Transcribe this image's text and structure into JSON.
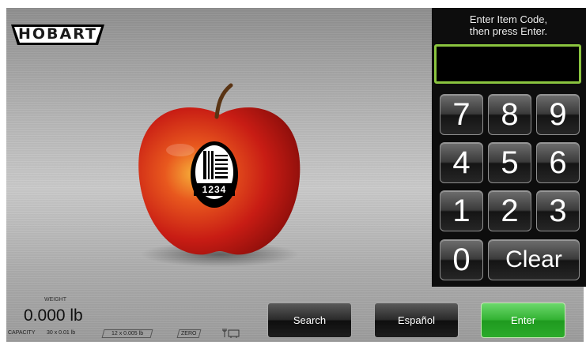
{
  "brand": {
    "logo_text": "HOBART"
  },
  "prompt": {
    "line1": "Enter Item Code,",
    "line2": "then press Enter."
  },
  "code_display": {
    "value": ""
  },
  "keypad": {
    "keys": [
      "7",
      "8",
      "9",
      "4",
      "5",
      "6",
      "1",
      "2",
      "3",
      "0"
    ],
    "clear_label": "Clear"
  },
  "product": {
    "name": "apple-icon",
    "label_code": "1234"
  },
  "buttons": {
    "search": "Search",
    "spanish": "Español",
    "enter": "Enter"
  },
  "weight": {
    "label": "WEIGHT",
    "value": "0.000 lb"
  },
  "capacity": {
    "label": "CAPACITY",
    "range1": "30 x 0.01 lb",
    "range2": "12 x 0.005 lb",
    "zero": "ZERO",
    "icon": "scale-icon"
  },
  "colors": {
    "enter_green": "#2bab2b",
    "display_border": "#8ac43f",
    "apple_red": "#d42b1c"
  }
}
